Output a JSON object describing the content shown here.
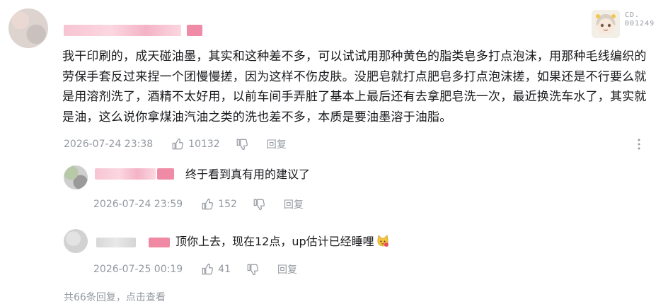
{
  "main_comment": {
    "text": "我干印刷的，成天碰油墨，其实和这种差不多，可以试试用那种黄色的脂类皂多打点泡沫，用那种毛线编织的劳保手套反过来捏一个团慢慢搓，因为这样不伤皮肤。没肥皂就打点肥皂多打点泡沫搓，如果还是不行要么就是用溶剂洗了，酒精不太好用，以前车间手弄脏了基本上最后还有去拿肥皂洗一次，最近换洗车水了，其实就是油，这么说你拿煤油汽油之类的洗也差不多，本质是要油墨溶于油脂。",
    "time": "2026-07-24 23:38",
    "likes": "10132",
    "reply_label": "回复",
    "badge_line1": "CD.",
    "badge_line2": "001249"
  },
  "replies": [
    {
      "text": "终于看到真有用的建议了",
      "time": "2026-07-24 23:59",
      "likes": "152",
      "reply_label": "回复"
    },
    {
      "text": "顶你上去，现在12点，up估计已经睡哩",
      "time": "2026-07-25 00:19",
      "likes": "41",
      "reply_label": "回复"
    }
  ],
  "footer": {
    "summary": "共66条回复，点击查看"
  },
  "colors": {
    "text": "#18191c",
    "meta": "#9499a0",
    "name_blur": "#f7c4d2"
  }
}
